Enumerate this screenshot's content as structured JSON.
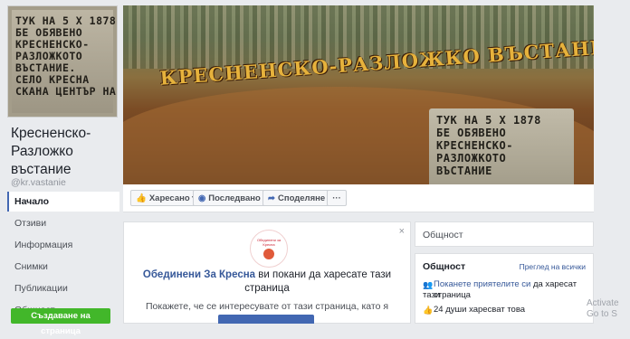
{
  "profile": {
    "stone_lines": [
      "ТУК НА 5 Х 1878",
      "БЕ ОБЯВЕНО",
      "КРЕСНЕНСКО-",
      "РАЗЛОЖКОТО",
      "ВЪСТАНИЕ.",
      "СЕЛО КРЕСНА",
      "СКАНА ЦЕНТЪР НА"
    ],
    "name": "Кресненско-Разложко въстание",
    "handle": "@kr.vastanie"
  },
  "nav": {
    "items": [
      "Начало",
      "Отзиви",
      "Информация",
      "Снимки",
      "Публикации",
      "Общност"
    ],
    "create_page": "Създаване на страница"
  },
  "cover": {
    "title": "КРЕСНЕНСКО-РАЗЛОЖКО ВЪСТАНИЕ",
    "stone_lines": [
      "ТУК НА 5 Х 1878",
      "БЕ ОБЯВЕНО",
      "КРЕСНЕНСКО-",
      "РАЗЛОЖКОТО",
      "ВЪСТАНИЕ"
    ]
  },
  "actions": {
    "like": "Харесано ▾",
    "follow": "Последвано ▾",
    "share": "Споделяне",
    "more": "···"
  },
  "invite": {
    "close": "×",
    "logo_text": "Обединени за Кресна",
    "org": "Обединени За Кресна",
    "text1": "ви покани да харесате тази",
    "text2": "страница",
    "text3": "Покажете, че се интересувате от тази страница, като я харесате."
  },
  "community_small": {
    "title": "Общност"
  },
  "community": {
    "title": "Общност",
    "see_all": "Преглед на всички",
    "invite_link": "Поканете приятелите си",
    "invite_rest": "да харесат тази",
    "invite_line2": "страница",
    "likes": "24 души харесват това"
  },
  "watermark": [
    "Activate",
    "Go to S"
  ],
  "colors": {
    "accent": "#4267b2",
    "link": "#365899",
    "green": "#42b72a",
    "bg": "#e9ebee"
  }
}
